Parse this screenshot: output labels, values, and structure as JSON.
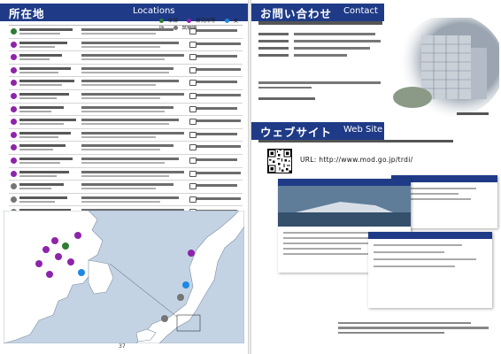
{
  "left_page": {
    "section_title_jp": "所在地",
    "section_title_en": "Locations",
    "legend": [
      {
        "label": "本部",
        "color": "#2e7d32"
      },
      {
        "label": "研究所等",
        "color": "#8e24aa"
      },
      {
        "label": "支所",
        "color": "#1e88e5"
      },
      {
        "label": "試験場",
        "color": "#757575"
      }
    ],
    "locations": [
      {
        "color": "#2e7d32"
      },
      {
        "color": "#8e24aa"
      },
      {
        "color": "#8e24aa"
      },
      {
        "color": "#8e24aa"
      },
      {
        "color": "#8e24aa"
      },
      {
        "color": "#8e24aa"
      },
      {
        "color": "#8e24aa"
      },
      {
        "color": "#8e24aa"
      },
      {
        "color": "#8e24aa"
      },
      {
        "color": "#8e24aa"
      },
      {
        "color": "#8e24aa"
      },
      {
        "color": "#8e24aa"
      },
      {
        "color": "#757575"
      },
      {
        "color": "#757575"
      },
      {
        "color": "#757575"
      }
    ],
    "page_number": "37"
  },
  "right_page": {
    "contact_title_jp": "お問い合わせ",
    "contact_title_en": "Contact",
    "website_title_jp": "ウェブサイト",
    "website_title_en": "Web Site",
    "url_line": "URL: http://www.mod.go.jp/trdi/"
  },
  "colors": {
    "band": "#1f3b87",
    "land": "#ffffff",
    "sea": "#c3d3e4"
  }
}
